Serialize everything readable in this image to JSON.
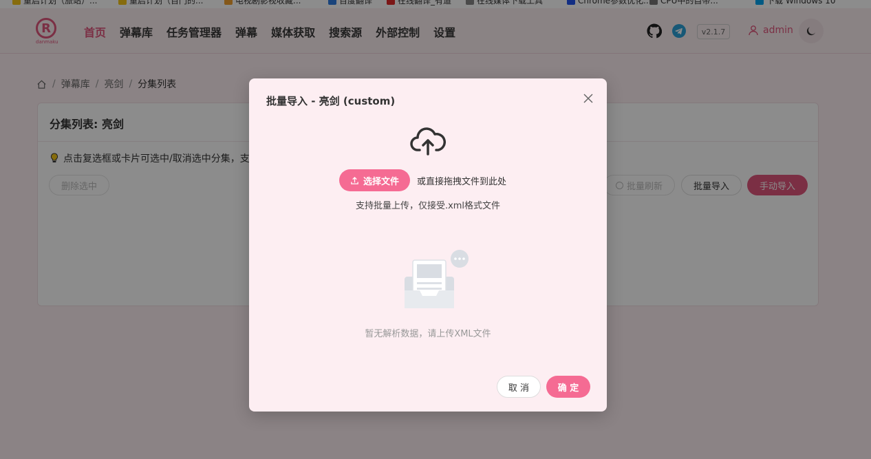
{
  "bookmarks": [
    {
      "label": "重启计划（旅站）..."
    },
    {
      "label": "重启计划（百门的..."
    },
    {
      "label": "电视剧影视收藏..."
    },
    {
      "label": "百度翻译"
    },
    {
      "label": "在线翻译_有道"
    },
    {
      "label": "在线媒体下载工具"
    },
    {
      "label": "Chrome参数优化..."
    },
    {
      "label": "CPU中的自带..."
    },
    {
      "label": "下载 Windows 10"
    }
  ],
  "app": {
    "logo_text": "danmaku",
    "logo_letter": "R"
  },
  "nav": {
    "items": [
      "首页",
      "弹幕库",
      "任务管理器",
      "弹幕",
      "媒体获取",
      "搜索源",
      "外部控制",
      "设置"
    ],
    "active": "首页",
    "version": "v2.1.7",
    "username": "admin"
  },
  "breadcrumb": {
    "items": [
      "弹幕库",
      "亮剑",
      "分集列表"
    ]
  },
  "card": {
    "title": "分集列表: 亮剑",
    "tip": "点击复选框或卡片可选中/取消选中分集，支持...",
    "delete_selected": "删除选中",
    "batch_refresh": "批量刷新",
    "batch_import": "批量导入",
    "manual_import": "手动导入"
  },
  "modal": {
    "title": "批量导入 - 亮剑 (custom)",
    "select_file": "选择文件",
    "drag_text": "或直接拖拽文件到此处",
    "hint": "支持批量上传，仅接受.xml格式文件",
    "empty_text": "暂无解析数据，请上传XML文件",
    "cancel": "取 消",
    "confirm": "确 定"
  },
  "colors": {
    "accent": "#e0577d",
    "button_pink": "#f56b93",
    "modal_bg": "#fdeef2",
    "page_bg": "#fdeff2"
  }
}
